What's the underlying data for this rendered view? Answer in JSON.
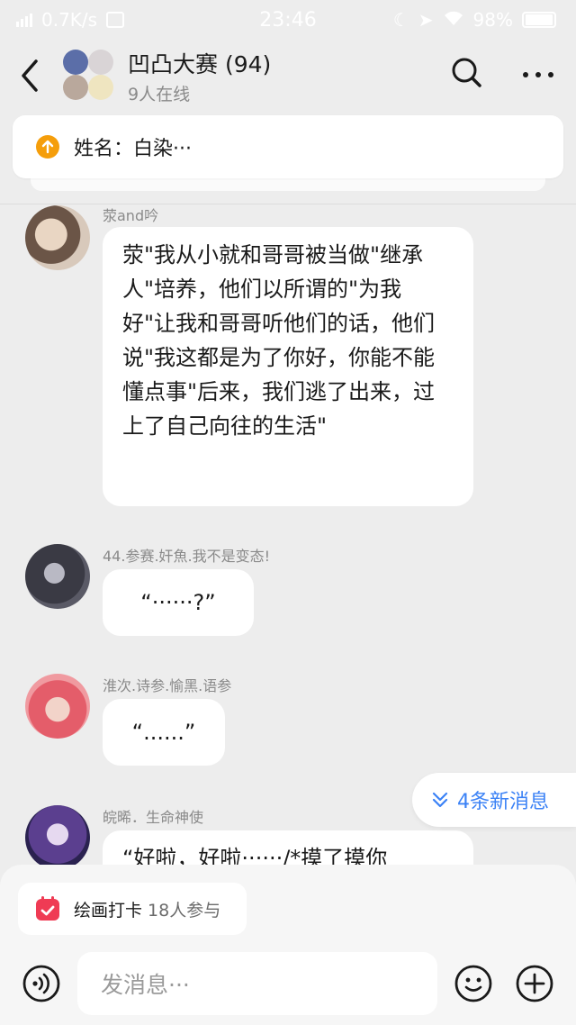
{
  "status": {
    "speed": "0.7K/s",
    "time": "23:46",
    "battery": "98%"
  },
  "header": {
    "title": "凹凸大赛 (94)",
    "subtitle": "9人在线"
  },
  "pinned": {
    "text": "姓名：白染···"
  },
  "messages": [
    {
      "sender": "荥and吟",
      "text": "荥\"我从小就和哥哥被当做\"继承人\"培养，他们以所谓的\"为我好\"让我和哥哥听他们的话，他们说\"我这都是为了你好，你能不能懂点事\"后来，我们逃了出来，过上了自己向往的生活\""
    },
    {
      "sender": "44.参赛.奸魚.我不是变态!",
      "text": "“······?”"
    },
    {
      "sender": "淮次.诗参.愉黑.语参",
      "text": "“......”"
    },
    {
      "sender": "皖晞．生命神使",
      "text": "“好啦，好啦······/*摸了摸你"
    }
  ],
  "new_messages": "4条新消息",
  "checkin": {
    "title": "绘画打卡",
    "participants": "18人参与"
  },
  "input": {
    "placeholder": "发消息···"
  },
  "colors": {
    "accent": "#3b82f6",
    "pinned_icon": "#f59e0b",
    "checkin_icon": "#ef3b54"
  }
}
